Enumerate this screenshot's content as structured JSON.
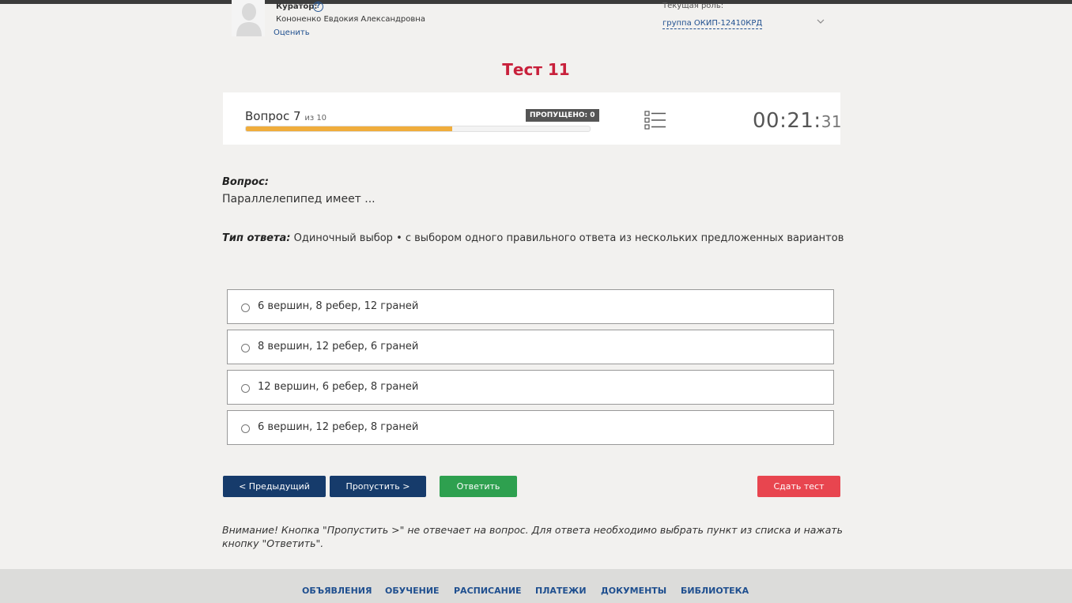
{
  "header": {
    "curator_label": "Куратор:",
    "curator_help": "?",
    "curator_name": "Кононенко Евдокия Александровна",
    "rate_label": "Оценить",
    "role_label": "Текущая роль:",
    "role_value": "группа ОКИП-12410КРД"
  },
  "test": {
    "title": "Тест 11"
  },
  "progress": {
    "question_label": "Вопрос 7",
    "question_of": "из 10",
    "skipped_badge": "ПРОПУЩЕНО: 0",
    "progress_fraction": 0.6,
    "timer_main": "00:21:",
    "timer_seconds": "31"
  },
  "question": {
    "heading": "Вопрос:",
    "text": "Параллелепипед имеет ...",
    "type_label": "Тип ответа:",
    "type_value": "Одиночный выбор • с выбором одного правильного ответа из нескольких предложенных вариантов"
  },
  "options": [
    "6 вершин, 8 ребер, 12 граней",
    "8 вершин, 12 ребер, 6 граней",
    "12 вершин, 6 ребер, 8 граней",
    "6 вершин, 12 ребер, 8 граней"
  ],
  "buttons": {
    "prev": "< Предыдущий",
    "skip": "Пропустить >",
    "answer": "Ответить",
    "submit": "Сдать тест"
  },
  "warning": "Внимание! Кнопка \"Пропустить >\" не отвечает на вопрос. Для ответа необходимо выбрать пункт из списка и нажать кнопку \"Ответить\".",
  "footer": {
    "links": [
      "ОБЪЯВЛЕНИЯ",
      "ОБУЧЕНИЕ",
      "РАСПИСАНИЕ",
      "ПЛАТЕЖИ",
      "ДОКУМЕНТЫ",
      "БИБЛИОТЕКА"
    ]
  },
  "colors": {
    "accent_title": "#c8203b",
    "primary_button": "#163b6b",
    "answer_button": "#2ea04f",
    "submit_button": "#e8454f",
    "progress_fill": "#f0ad3c"
  }
}
